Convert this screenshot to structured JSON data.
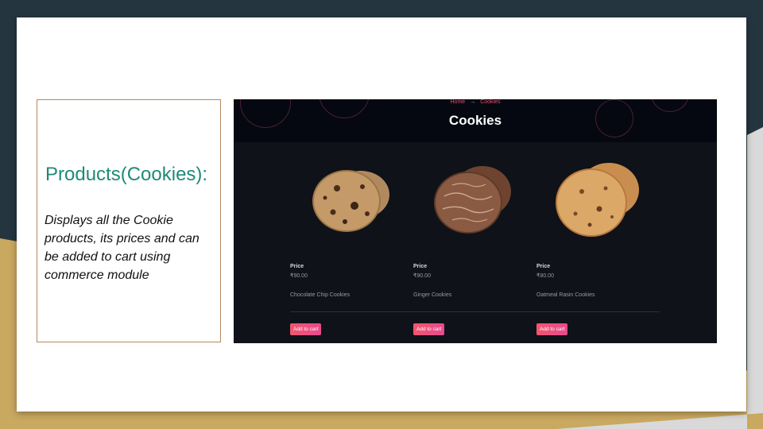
{
  "slide": {
    "heading": "Products(Cookies):",
    "description": "Displays all the Cookie products, its prices and can be added to cart using commerce module"
  },
  "colors": {
    "background_dark": "#24353f",
    "background_gold": "#c9a860",
    "heading_teal": "#1f8a77",
    "textbox_border": "#b5875f",
    "site_dark": "#0f1218",
    "accent_pink": "#f0576e"
  },
  "site": {
    "breadcrumb": {
      "home": "Home",
      "arrow": "→",
      "current": "Cookies"
    },
    "page_title": "Cookies",
    "products": [
      {
        "price_label": "Price",
        "price": "₹90.00",
        "name": "Chocolate Chip Cookies",
        "button": "Add to cart",
        "image": "chocolate-chip-cookie"
      },
      {
        "price_label": "Price",
        "price": "₹90.00",
        "name": "Ginger Cookies",
        "button": "Add to cart",
        "image": "ginger-cookie"
      },
      {
        "price_label": "Price",
        "price": "₹80.00",
        "name": "Oatmeal Rasin Cookies",
        "button": "Add to cart",
        "image": "oatmeal-cookie"
      }
    ]
  }
}
